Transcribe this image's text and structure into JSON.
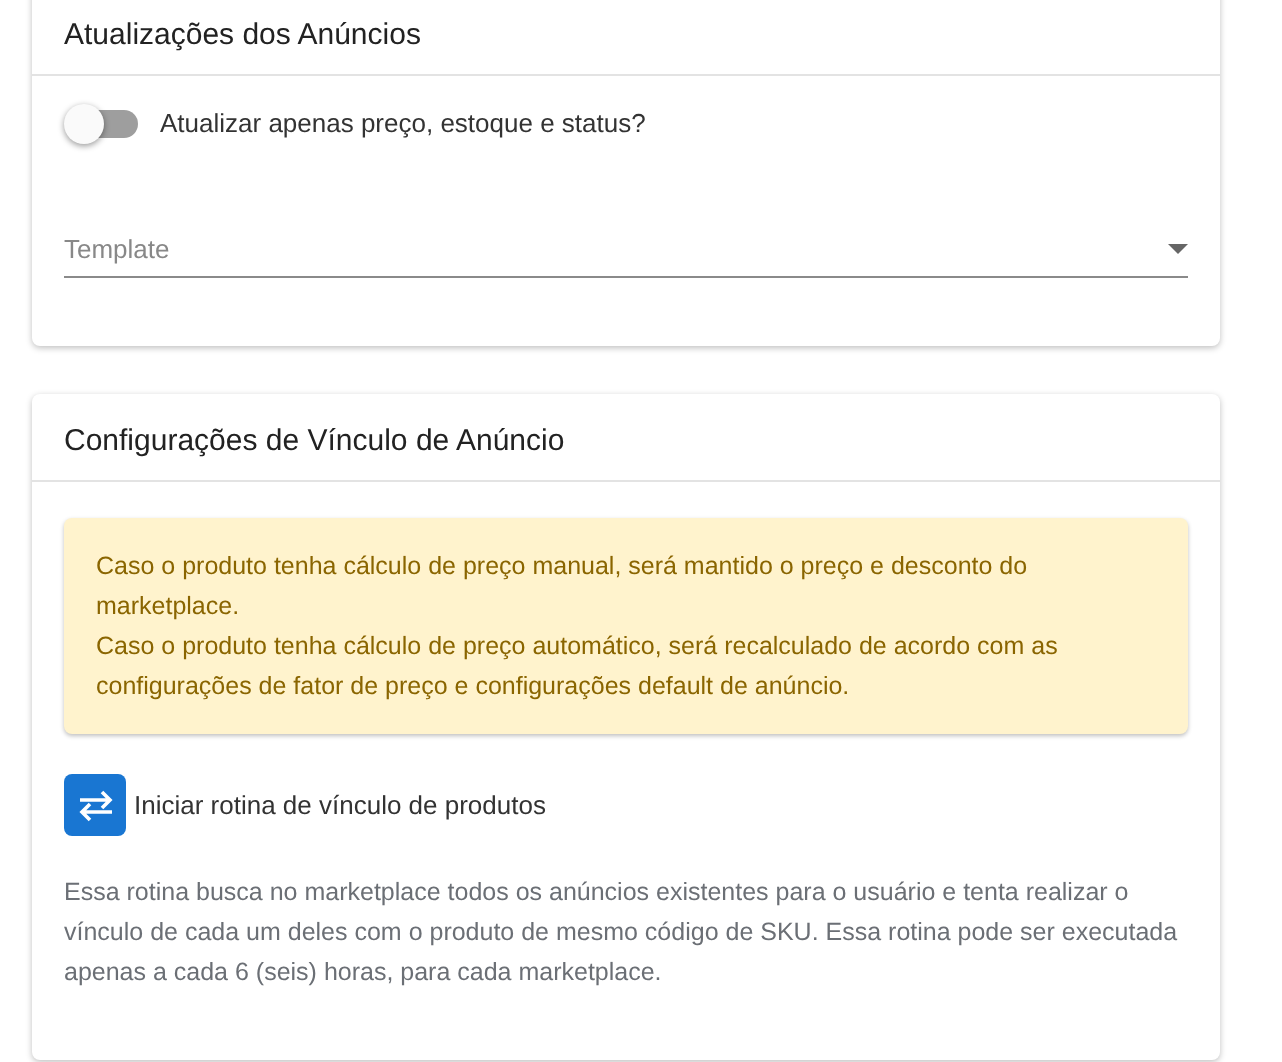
{
  "cards": [
    {
      "title": "Atualizações dos Anúncios",
      "toggle": {
        "label": "Atualizar apenas preço, estoque e status?",
        "on": false
      },
      "select": {
        "placeholder": "Template"
      }
    },
    {
      "title": "Configurações de Vínculo de Anúncio",
      "alert": [
        "Caso o produto tenha cálculo de preço manual, será mantido o preço e desconto do marketplace.",
        "Caso o produto tenha cálculo de preço automático, será recalculado de acordo com as configurações de fator de preço e configurações default de anúncio."
      ],
      "action": {
        "label": "Iniciar rotina de vínculo de produtos"
      },
      "description": "Essa rotina busca no marketplace todos os anúncios existentes para o usuário e tenta realizar o vínculo de cada um deles com o produto de mesmo código de SKU. Essa rotina pode ser executada apenas a cada 6 (seis) horas, para cada marketplace."
    }
  ]
}
